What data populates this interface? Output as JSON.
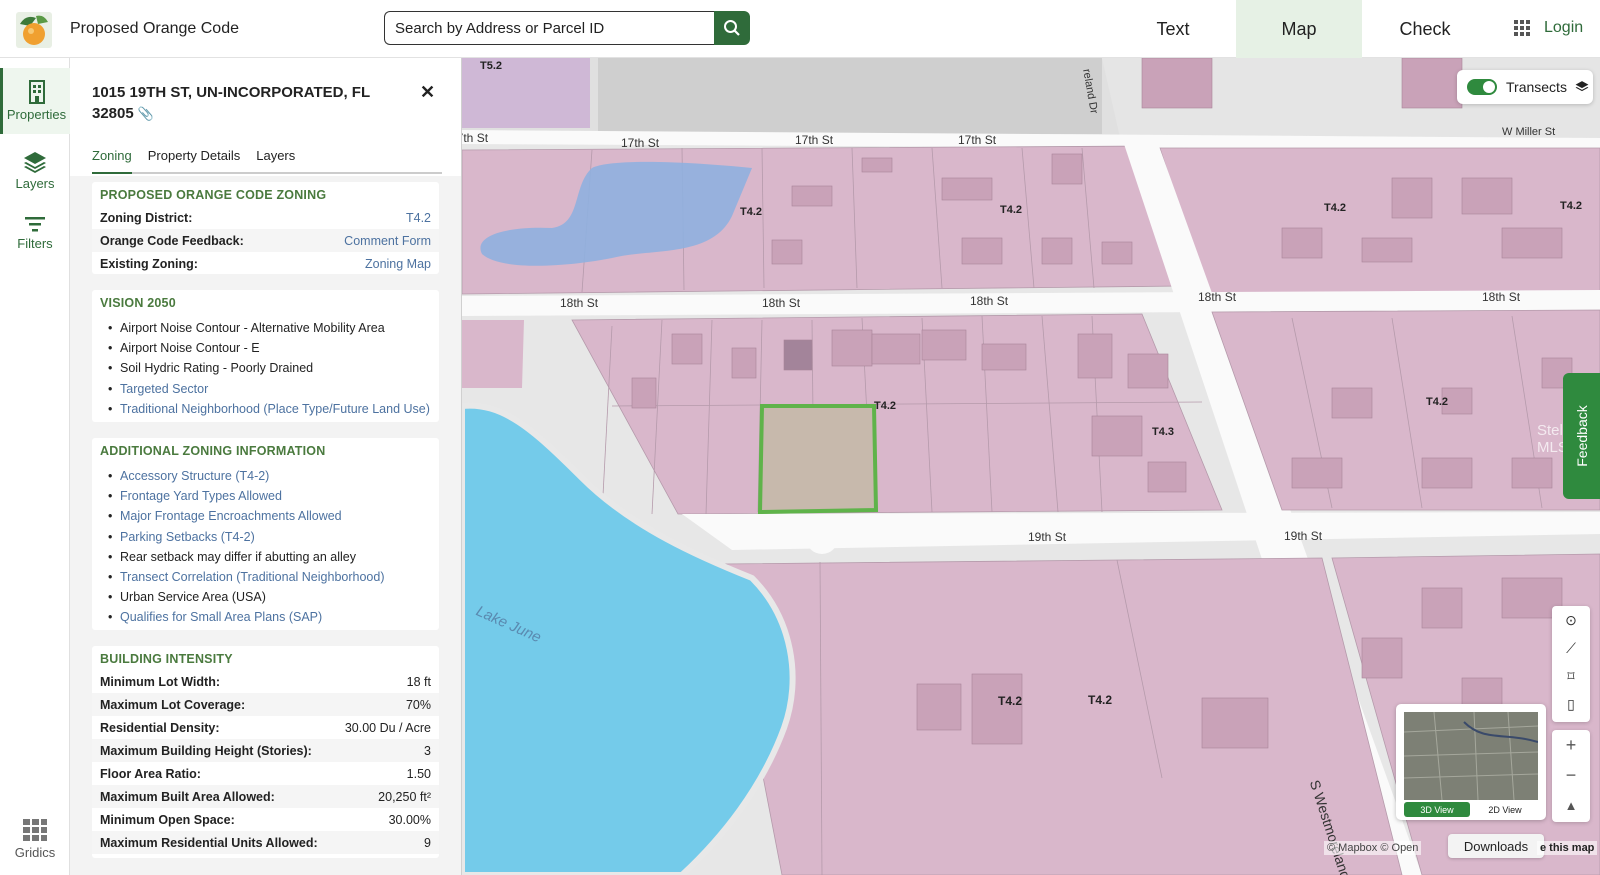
{
  "header": {
    "app_title": "Proposed Orange Code",
    "search_placeholder": "Search by Address or Parcel ID",
    "tabs": [
      {
        "label": "Text"
      },
      {
        "label": "Map"
      },
      {
        "label": "Check"
      }
    ],
    "active_tab": "Map",
    "login_label": "Login"
  },
  "rail": {
    "items": [
      {
        "label": "Properties",
        "icon": "building-icon",
        "active": true
      },
      {
        "label": "Layers",
        "icon": "layers-icon",
        "active": false
      },
      {
        "label": "Filters",
        "icon": "filter-icon",
        "active": false
      }
    ],
    "bottom_label": "Gridics"
  },
  "panel": {
    "address_line1": "1015 19TH ST, UN-INCORPORATED, FL",
    "address_line2": "32805",
    "tabs": [
      "Zoning",
      "Property Details",
      "Layers"
    ],
    "zoning_section": {
      "title": "PROPOSED ORANGE CODE ZONING",
      "rows": [
        {
          "k": "Zoning District:",
          "v": "T4.2"
        },
        {
          "k": "Orange Code Feedback:",
          "v": "Comment Form"
        },
        {
          "k": "Existing Zoning:",
          "v": "Zoning Map"
        }
      ]
    },
    "vision_section": {
      "title": "VISION 2050",
      "items": [
        {
          "text": "Airport Noise Contour - Alternative Mobility Area",
          "link": false
        },
        {
          "text": "Airport Noise Contour - E",
          "link": false
        },
        {
          "text": "Soil Hydric Rating - Poorly Drained",
          "link": false
        },
        {
          "text": "Targeted Sector",
          "link": true
        },
        {
          "text": "Traditional Neighborhood (Place Type/Future Land Use)",
          "link": true
        }
      ]
    },
    "additional_section": {
      "title": "ADDITIONAL ZONING INFORMATION",
      "items": [
        {
          "text": "Accessory Structure (T4-2)",
          "link": true
        },
        {
          "text": "Frontage Yard Types Allowed",
          "link": true
        },
        {
          "text": "Major Frontage Encroachments Allowed",
          "link": true
        },
        {
          "text": "Parking Setbacks (T4-2)",
          "link": true
        },
        {
          "text": "Rear setback may differ if abutting an alley",
          "link": false
        },
        {
          "text": "Transect Correlation (Traditional Neighborhood)",
          "link": true
        },
        {
          "text": "Urban Service Area (USA)",
          "link": false
        },
        {
          "text": "Qualifies for Small Area Plans (SAP)",
          "link": true
        }
      ]
    },
    "intensity_section": {
      "title": "BUILDING INTENSITY",
      "rows": [
        {
          "k": "Minimum Lot Width:",
          "v": "18 ft"
        },
        {
          "k": "Maximum Lot Coverage:",
          "v": "70%"
        },
        {
          "k": "Residential Density:",
          "v": "30.00 Du / Acre"
        },
        {
          "k": "Maximum Building Height (Stories):",
          "v": "3"
        },
        {
          "k": "Floor Area Ratio:",
          "v": "1.50"
        },
        {
          "k": "Maximum Built Area Allowed:",
          "v": "20,250 ft²"
        },
        {
          "k": "Minimum Open Space:",
          "v": "30.00%"
        },
        {
          "k": "Maximum Residential Units Allowed:",
          "v": "9"
        }
      ]
    }
  },
  "map": {
    "streets": {
      "s17a": "17th St",
      "s17b": "17th St",
      "s17c": "17th St",
      "s18a": "18th St",
      "s18b": "18th St",
      "s18c": "18th St",
      "s18d": "18th St",
      "s18e": "18th St",
      "s19a": "19th St",
      "s19b": "19th St",
      "w_miller": "W Miller St",
      "westmoreland": "S Westmoreland",
      "reland": "reland Dr"
    },
    "zone_labels": {
      "t52": "T5.2",
      "z1": "T4.2",
      "z2": "T4.2",
      "z3": "T4.2",
      "z4": "T4.2",
      "z5": "T4.2",
      "z6": "T4.2",
      "z7": "T4.3",
      "z8": "T4.2",
      "z9": "T4.2",
      "z10": "T4.2"
    },
    "lake_label": "Lake June",
    "transects_label": "Transects",
    "transects_on": true,
    "feedback_label": "Feedback",
    "minimap": {
      "view_3d": "3D View",
      "view_2d": "2D View",
      "active": "3D View"
    },
    "downloads_label": "Downloads",
    "attribution": "© Mapbox © Open",
    "attribution_tail": "e this map",
    "watermark": "Stellar MLS"
  },
  "colors": {
    "brand_green": "#2f6b3a",
    "zone_pink": "#d9b7cb",
    "water": "#74cbea",
    "selected_parcel": "#5fb34a",
    "link_blue": "#4d72a0"
  }
}
